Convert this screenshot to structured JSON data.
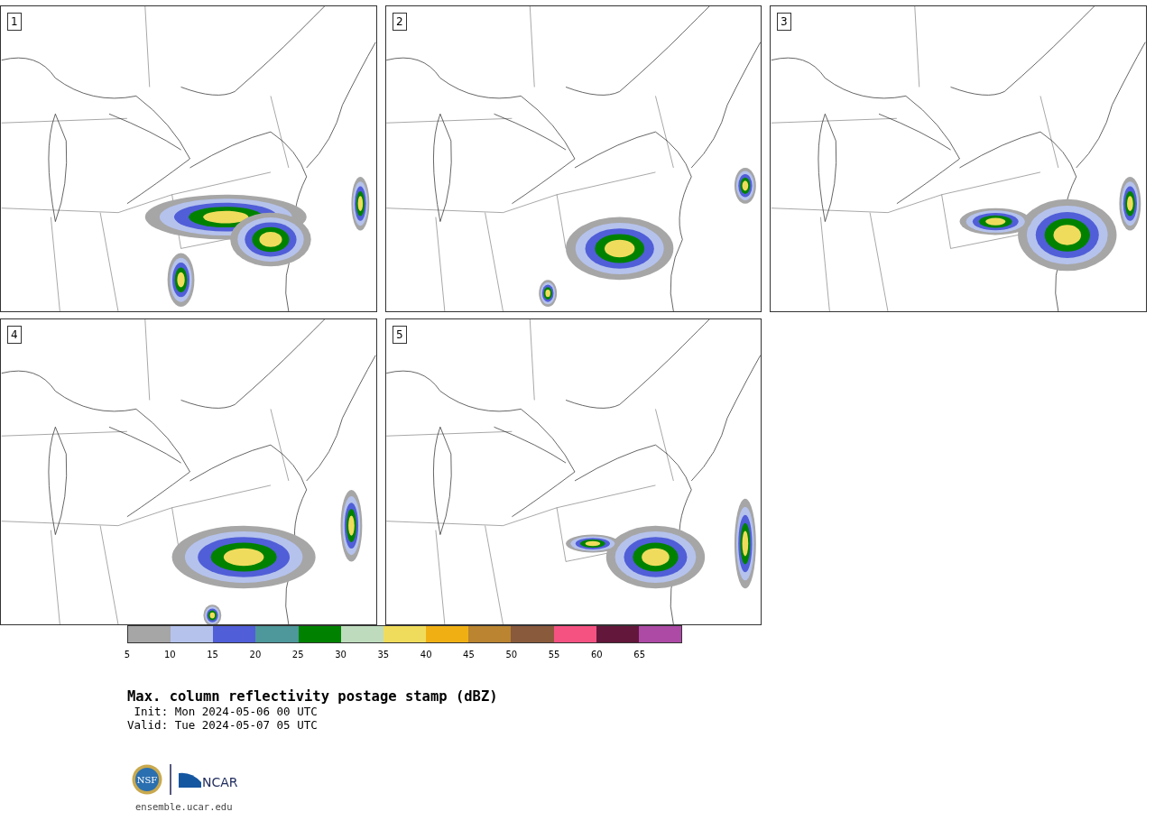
{
  "panels": [
    {
      "number": "1"
    },
    {
      "number": "2"
    },
    {
      "number": "3"
    },
    {
      "number": "4"
    },
    {
      "number": "5"
    }
  ],
  "colorbar": {
    "segments": [
      {
        "color": "#a6a6a6"
      },
      {
        "color": "#b5c2ec"
      },
      {
        "color": "#505ed8"
      },
      {
        "color": "#4e979a"
      },
      {
        "color": "#008200"
      },
      {
        "color": "#bedcbd"
      },
      {
        "color": "#f0dc5c"
      },
      {
        "color": "#f0b014"
      },
      {
        "color": "#ba8430"
      },
      {
        "color": "#8a5a3c"
      },
      {
        "color": "#f55282"
      },
      {
        "color": "#63173a"
      },
      {
        "color": "#ac4aa6"
      }
    ],
    "ticks": [
      "5",
      "10",
      "15",
      "20",
      "25",
      "30",
      "35",
      "40",
      "45",
      "50",
      "55",
      "60",
      "65"
    ]
  },
  "title": "Max. column reflectivity postage stamp (dBZ)",
  "init": " Init: Mon 2024-05-06 00 UTC",
  "valid": "Valid: Tue 2024-05-07 05 UTC",
  "logos": {
    "nsf": "NSF",
    "ncar": "NCAR"
  },
  "url": "ensemble.ucar.edu"
}
